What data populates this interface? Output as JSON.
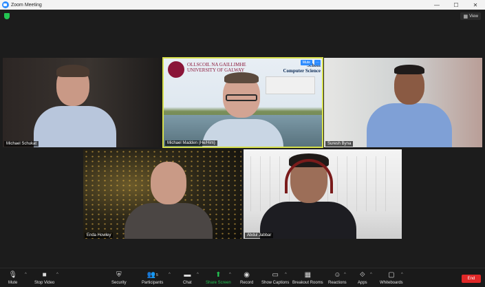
{
  "window": {
    "title": "Zoom Meeting",
    "minimize": "—",
    "maximize": "☐",
    "close": "✕"
  },
  "meeting": {
    "view_label": "View",
    "active_speaker_mute": "Mute",
    "active_speaker_more": "···",
    "background_text": {
      "university_line1": "OLLSCOIL NA GAILLIMHE",
      "university_line2": "UNIVERSITY OF GALWAY",
      "school_line1": "School",
      "school_line2": "Computer Science"
    },
    "participants": [
      {
        "name": "Michael Schukat"
      },
      {
        "name": "Michael Madden (He/Him)"
      },
      {
        "name": "Suresh Byna"
      },
      {
        "name": "Enda Howley"
      },
      {
        "name": "Abdul Jabbar"
      }
    ]
  },
  "toolbar": {
    "mute": "Mute",
    "stop_video": "Stop Video",
    "security": "Security",
    "participants": "Participants",
    "participants_count": "5",
    "chat": "Chat",
    "share_screen": "Share Screen",
    "record": "Record",
    "show_captions": "Show Captions",
    "breakout_rooms": "Breakout Rooms",
    "reactions": "Reactions",
    "apps": "Apps",
    "whiteboards": "Whiteboards",
    "end": "End"
  },
  "colors": {
    "active_speaker_border": "#d7e04b",
    "share_green": "#23c552",
    "end_red": "#e02828",
    "zoom_blue": "#2d8cff"
  }
}
